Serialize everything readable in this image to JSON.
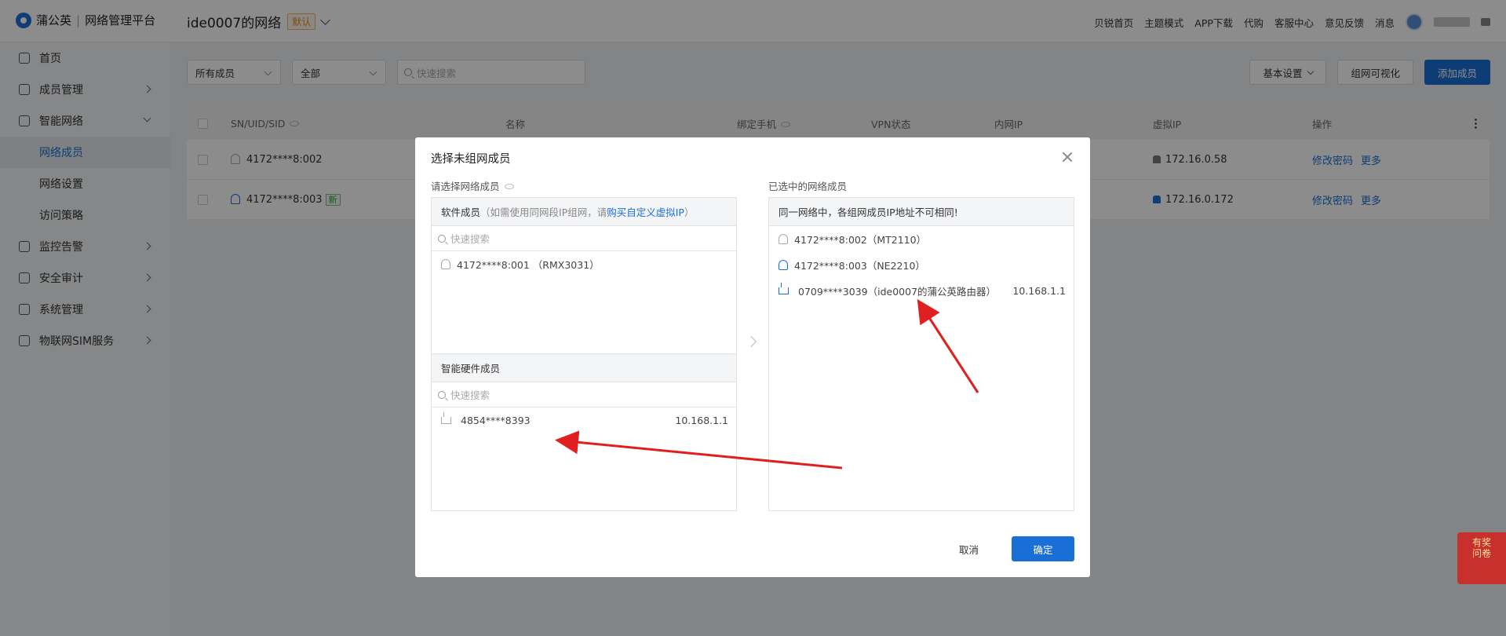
{
  "app": {
    "brand": "蒲公英",
    "platform": "网络管理平台",
    "network_name": "ide0007的网络",
    "default_badge": "默认"
  },
  "topnav": [
    "贝锐首页",
    "主题模式",
    "APP下载",
    "代购",
    "客服中心",
    "意见反馈",
    "消息"
  ],
  "sidebar": {
    "items": [
      {
        "label": "首页"
      },
      {
        "label": "成员管理"
      },
      {
        "label": "智能网络"
      },
      {
        "label": "网络成员"
      },
      {
        "label": "网络设置"
      },
      {
        "label": "访问策略"
      },
      {
        "label": "监控告警"
      },
      {
        "label": "安全审计"
      },
      {
        "label": "系统管理"
      },
      {
        "label": "物联网SIM服务"
      }
    ]
  },
  "toolbar": {
    "filter1": "所有成员",
    "filter2": "全部",
    "search_placeholder": "快速搜索",
    "basic_settings": "基本设置",
    "visualize": "组网可视化",
    "add_member": "添加成员"
  },
  "table": {
    "headers": [
      "SN/UID/SID",
      "名称",
      "绑定手机",
      "VPN状态",
      "内网IP",
      "虚拟IP",
      "操作"
    ],
    "rows": [
      {
        "id": "4172****8:002",
        "new": "",
        "vip": "172.16.0.58",
        "edit": "修改密码",
        "more": "更多"
      },
      {
        "id": "4172****8:003",
        "new": "新",
        "vip": "172.16.0.172",
        "edit": "修改密码",
        "more": "更多"
      }
    ]
  },
  "modal": {
    "title": "选择未组网成员",
    "left_label": "请选择网络成员",
    "right_label": "已选中的网络成员",
    "software_header": "软件成员",
    "software_note_pre": "（如需使用同网段IP组网，请 ",
    "software_note_link": "购买自定义虚拟IP",
    "software_note_post": " ）",
    "search_placeholder": "快速搜索",
    "software_items": [
      "4172****8:001 （RMX3031）"
    ],
    "hardware_header": "智能硬件成员",
    "hardware_items": [
      {
        "name": "4854****8393",
        "ip": "10.168.1.1"
      }
    ],
    "selected_header": "同一网络中，各组网成员IP地址不可相同!",
    "selected_items": [
      {
        "name": "4172****8:002（MT2110）",
        "ip": ""
      },
      {
        "name": "4172****8:003（NE2210）",
        "ip": ""
      },
      {
        "name": "0709****3039（ide0007的蒲公英路由器）",
        "ip": "10.168.1.1"
      }
    ],
    "cancel": "取消",
    "ok": "确定"
  },
  "promo": {
    "line1": "有奖",
    "line2": "问卷"
  },
  "colors": {
    "accent": "#1a6fd6",
    "arrow": "#e02020"
  }
}
